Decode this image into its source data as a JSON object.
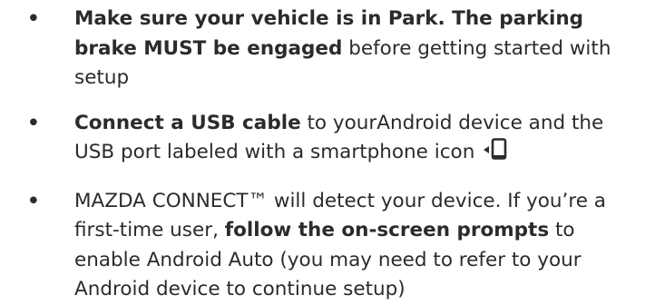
{
  "items": [
    {
      "segments": [
        {
          "text": "Make sure your vehicle is in Park. The parking brake MUST be engaged",
          "bold": true
        },
        {
          "text": " before getting started with setup",
          "bold": false
        }
      ]
    },
    {
      "segments": [
        {
          "text": "Connect a USB cable",
          "bold": true
        },
        {
          "text": " to yourAndroid device and the USB port labeled with a smartphone icon ",
          "bold": false
        }
      ],
      "trailing_icon": "smartphone-icon"
    },
    {
      "segments": [
        {
          "text": "MAZDA CONNECT™ will detect your device. If you’re a first-time user, ",
          "bold": false
        },
        {
          "text": "follow the on-screen prompts",
          "bold": true
        },
        {
          "text": " to enable Android Auto (you may need to refer to your Android device to continue setup)",
          "bold": false
        }
      ]
    }
  ],
  "bullet_char": "•",
  "colors": {
    "text": "#2b2b2b",
    "background": "#ffffff"
  }
}
